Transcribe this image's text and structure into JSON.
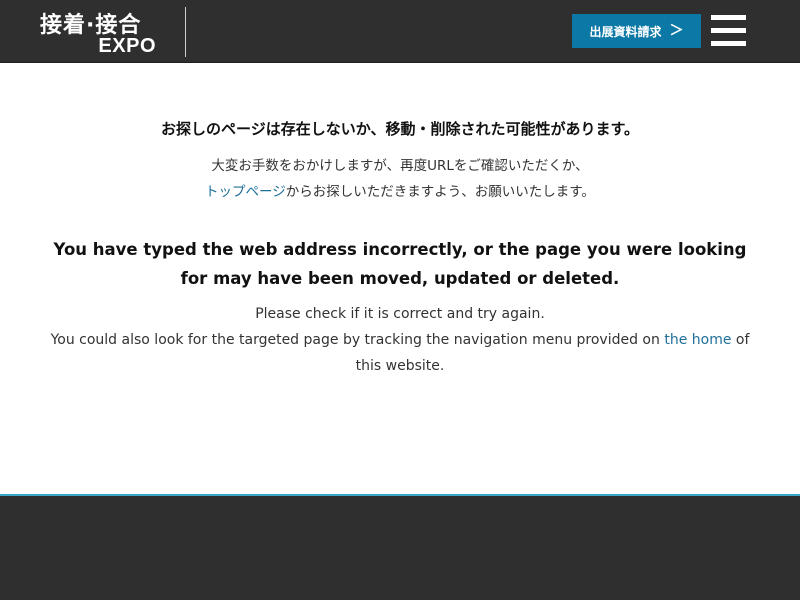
{
  "header": {
    "logo_line1": "接着·接合",
    "logo_line2": "EXPO",
    "cta_label": "出展資料請求",
    "cta_icon": "＞"
  },
  "error": {
    "jp_heading": "お探しのページは存在しないか、移動・削除された可能性があります。",
    "jp_body_line1": "大変お手数をおかけしますが、再度URLをご確認いただくか、",
    "jp_link": "トップページ",
    "jp_body_line2_rest": "からお探しいただきますよう、お願いいたします。",
    "en_heading": "You have typed the web address incorrectly, or the page you were looking for may have been moved, updated or deleted.",
    "en_body_line1": "Please check if it is correct and try again.",
    "en_body_line2_start": "You could also look for the targeted page by tracking the navigation menu provided on ",
    "en_link": "the home",
    "en_body_line2_end": " of this website."
  },
  "colors": {
    "header_bg": "#2f2f2f",
    "accent": "#0b78a6",
    "link": "#1f6f99",
    "footer_rule": "#3aa7c7"
  }
}
